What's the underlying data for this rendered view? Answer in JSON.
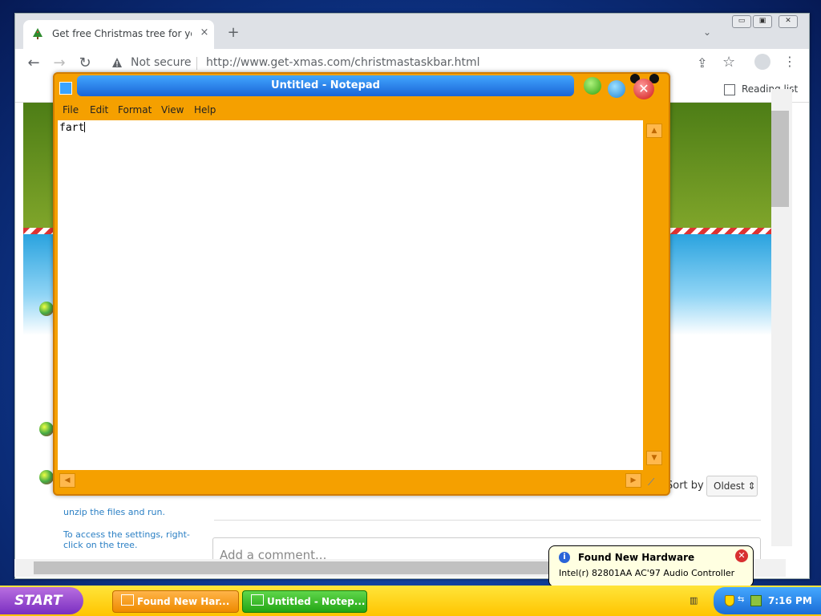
{
  "browser": {
    "tab_title": "Get free Christmas tree for your taskbar",
    "tab_close": "×",
    "new_tab": "+",
    "tab_search": "⌄",
    "window_controls": {
      "minimize": "▭",
      "maximize": "▣",
      "close": "✕"
    },
    "nav": {
      "back": "←",
      "forward": "→",
      "reload": "↻"
    },
    "security_label": "Not secure",
    "url": "http://www.get-xmas.com/christmastaskbar.html",
    "share": "⇪",
    "star": "☆",
    "menu": "⋮",
    "reading_list": "Reading list"
  },
  "page": {
    "sort_by_label": "Sort by",
    "sort_value": "Oldest ⇕",
    "unzip_text": "unzip the files and run.",
    "access_text": "To access the settings, right-click on the tree.",
    "comment_placeholder": "Add a comment..."
  },
  "notepad": {
    "title": "Untitled - Notepad",
    "close_glyph": "✕",
    "menu": [
      "File",
      "Edit",
      "Format",
      "View",
      "Help"
    ],
    "content": "fart",
    "scroll_up": "▲",
    "scroll_down": "▼",
    "scroll_left": "◀",
    "scroll_right": "▶",
    "grip": "⟋"
  },
  "taskbar": {
    "start_label": "START",
    "tasks": [
      "Found New Har...",
      "Untitled - Notep..."
    ],
    "clock": "7:16 PM"
  },
  "balloon": {
    "title": "Found New Hardware",
    "close_glyph": "✕",
    "info_glyph": "i",
    "text": "Intel(r) 82801AA AC'97 Audio Controller"
  },
  "colors": {
    "notepad_frame": "#f5a000",
    "notepad_titlebar": "#1a64d6",
    "taskbar": "#ffc400",
    "start_button": "#7a2fc0"
  }
}
